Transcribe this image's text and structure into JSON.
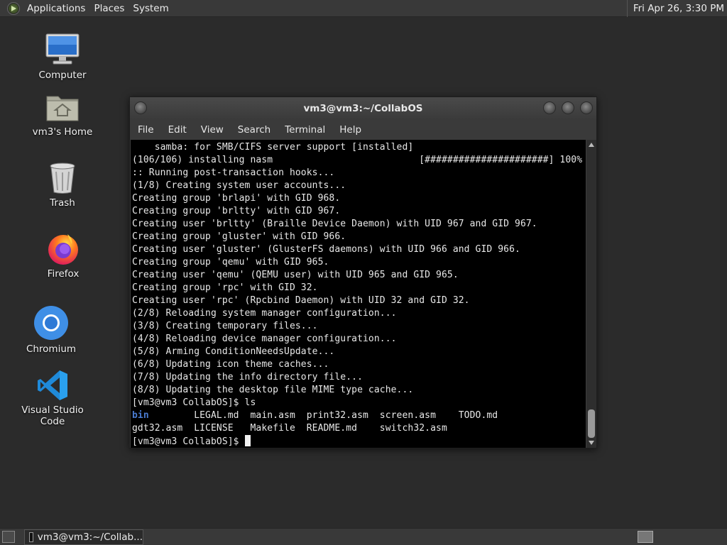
{
  "top_panel": {
    "menus": [
      "Applications",
      "Places",
      "System"
    ],
    "clock": "Fri Apr 26,  3:30 PM"
  },
  "desktop_icons": [
    {
      "label": "Computer",
      "icon": "computer-icon"
    },
    {
      "label": "vm3's Home",
      "icon": "home-folder-icon"
    },
    {
      "label": "Trash",
      "icon": "trash-icon"
    },
    {
      "label": "Firefox",
      "icon": "firefox-icon"
    },
    {
      "label": "Chromium",
      "icon": "chromium-icon"
    },
    {
      "label": "Visual Studio Code",
      "icon": "vscode-icon"
    }
  ],
  "terminal": {
    "title": "vm3@vm3:~/CollabOS",
    "menu": [
      "File",
      "Edit",
      "View",
      "Search",
      "Terminal",
      "Help"
    ],
    "lines": [
      "    samba: for SMB/CIFS server support [installed]",
      "(106/106) installing nasm                          [######################] 100%",
      ":: Running post-transaction hooks...",
      "(1/8) Creating system user accounts...",
      "Creating group 'brlapi' with GID 968.",
      "Creating group 'brltty' with GID 967.",
      "Creating user 'brltty' (Braille Device Daemon) with UID 967 and GID 967.",
      "Creating group 'gluster' with GID 966.",
      "Creating user 'gluster' (GlusterFS daemons) with UID 966 and GID 966.",
      "Creating group 'qemu' with GID 965.",
      "Creating user 'qemu' (QEMU user) with UID 965 and GID 965.",
      "Creating group 'rpc' with GID 32.",
      "Creating user 'rpc' (Rpcbind Daemon) with UID 32 and GID 32.",
      "(2/8) Reloading system manager configuration...",
      "(3/8) Creating temporary files...",
      "(4/8) Reloading device manager configuration...",
      "(5/8) Arming ConditionNeedsUpdate...",
      "(6/8) Updating icon theme caches...",
      "(7/8) Updating the info directory file...",
      "(8/8) Updating the desktop file MIME type cache...",
      "[vm3@vm3 CollabOS]$ ls"
    ],
    "ls_row1": {
      "dir": "bin",
      "rest": "        LEGAL.md  main.asm  print32.asm  screen.asm    TODO.md"
    },
    "ls_row2": "gdt32.asm  LICENSE   Makefile  README.md    switch32.asm",
    "prompt": "[vm3@vm3 CollabOS]$ "
  },
  "bottom_panel": {
    "task_label": "vm3@vm3:~/Collab..."
  }
}
